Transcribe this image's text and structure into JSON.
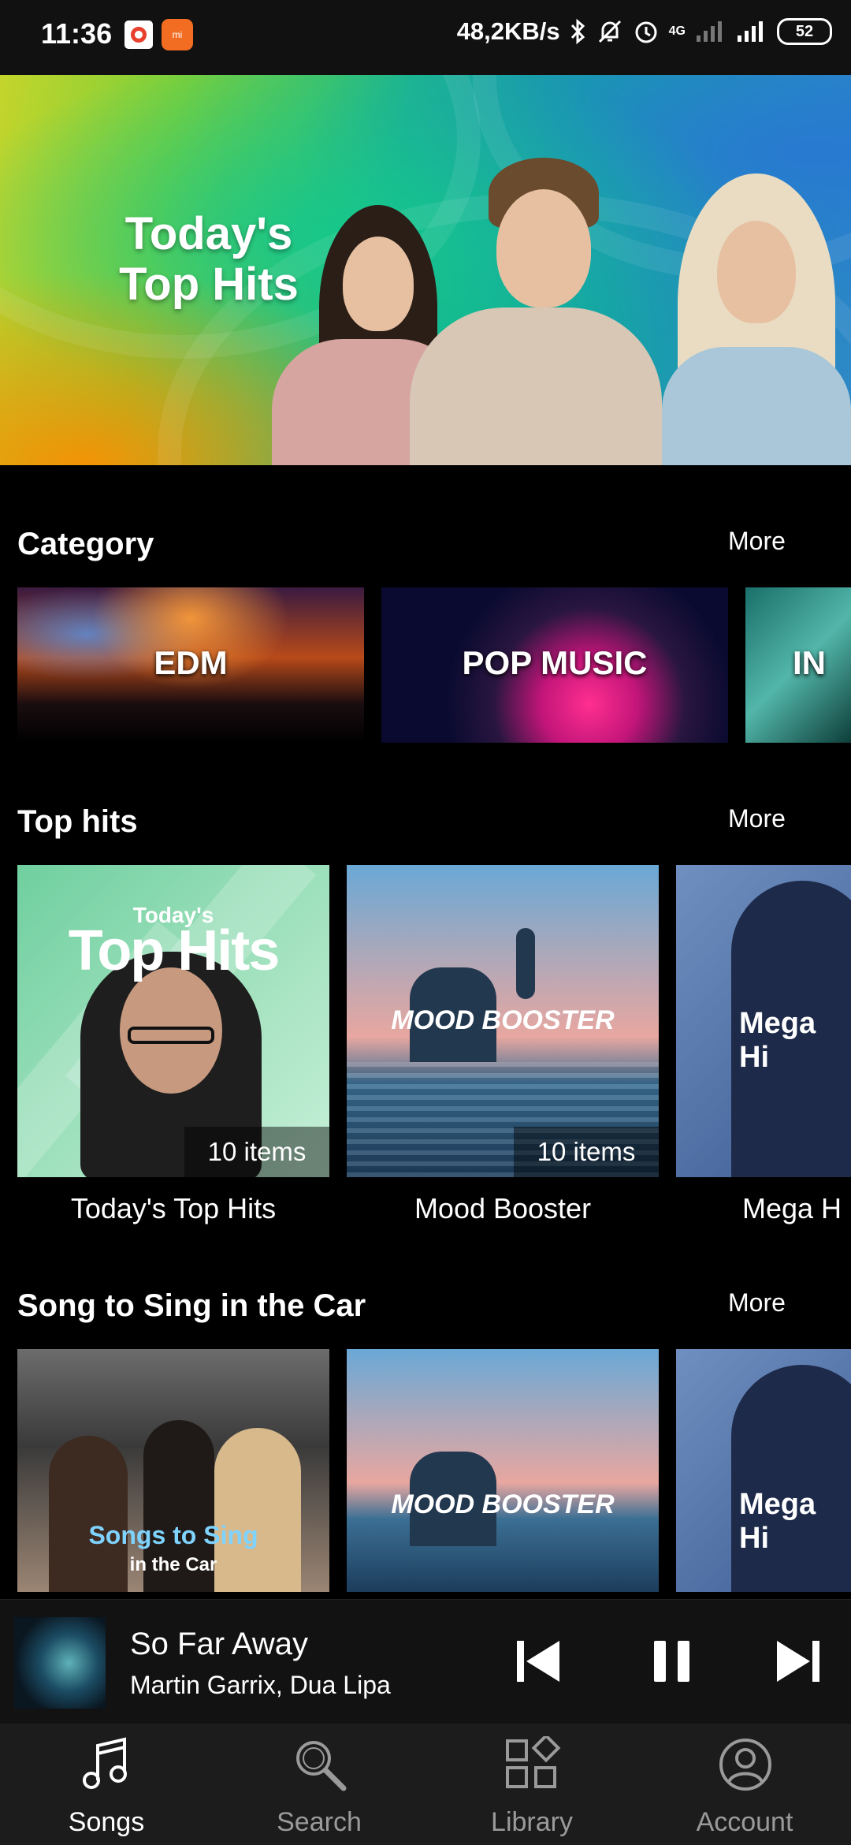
{
  "status_bar": {
    "time": "11:36",
    "speed": "48,2KB/s",
    "network": "4G",
    "battery": "52"
  },
  "banner": {
    "title_line1": "Today's",
    "title_line2": "Top Hits"
  },
  "category": {
    "title": "Category",
    "more": "More",
    "tiles": [
      {
        "label": "EDM"
      },
      {
        "label": "POP MUSIC"
      },
      {
        "label": "IN"
      }
    ]
  },
  "top_hits": {
    "title": "Top hits",
    "more": "More",
    "cards": [
      {
        "cover_top": "Today's",
        "cover_main": "Top Hits",
        "badge": "10 items",
        "caption": "Today's Top Hits"
      },
      {
        "cover_main": "MOOD BOOSTER",
        "badge": "10 items",
        "caption": "Mood Booster"
      },
      {
        "cover_main": "Mega Hi",
        "caption": "Mega H"
      }
    ]
  },
  "car_songs": {
    "title": "Song to Sing in the Car",
    "more": "More",
    "cards": [
      {
        "cover_main": "Songs to Sing",
        "cover_sub": "in the Car"
      },
      {
        "cover_main": "MOOD BOOSTER"
      },
      {
        "cover_main": "Mega Hi"
      }
    ]
  },
  "player": {
    "title": "So Far Away",
    "artist": "Martin Garrix, Dua Lipa"
  },
  "nav": {
    "items": [
      {
        "label": "Songs",
        "icon": "music-note-icon"
      },
      {
        "label": "Search",
        "icon": "search-icon"
      },
      {
        "label": "Library",
        "icon": "library-icon"
      },
      {
        "label": "Account",
        "icon": "account-icon"
      }
    ],
    "active": "Songs"
  }
}
